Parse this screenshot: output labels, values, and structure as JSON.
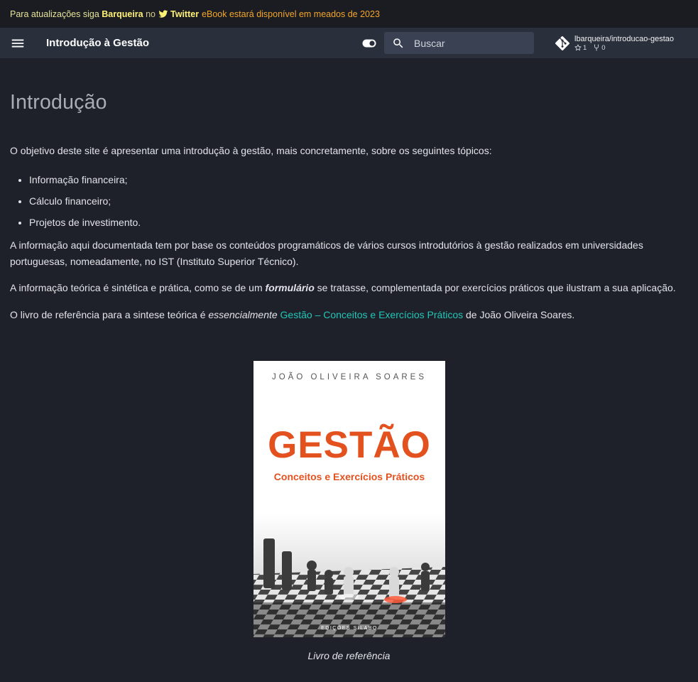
{
  "announcement": {
    "prefix": "Para atualizações siga",
    "name": "Barqueira",
    "connector": "no",
    "platform": "Twitter",
    "suffix": "eBook estará disponível em meados de 2023"
  },
  "header": {
    "title": "Introdução à Gestão",
    "search_placeholder": "Buscar",
    "repo": {
      "name": "lbarqueira/introducao-gestao",
      "stars": "1",
      "forks": "0"
    }
  },
  "main": {
    "heading": "Introdução",
    "intro": "O objetivo deste site é apresentar uma introdução à gestão, mais concretamente, sobre os seguintes tópicos:",
    "topics": [
      "Informação financeira;",
      "Cálculo financeiro;",
      "Projetos de investimento."
    ],
    "para_info": "A informação aqui documentada tem por base os conteúdos programáticos de vários cursos introdutórios à gestão realizados em universidades portuguesas, nomeadamente, no IST (Instituto Superior Técnico).",
    "para_theory_a": "A informação teórica é sintética e prática, como se de um ",
    "para_theory_em": "formulário",
    "para_theory_b": " se tratasse, complementada por exercícios práticos que ilustram a sua aplicação.",
    "para_ref_a": "O livro de referência para a sintese teórica é ",
    "para_ref_em": "essencialmente",
    "para_ref_link": "Gestão – Conceitos e Exercícios Práticos",
    "para_ref_b": " de João Oliveira Soares.",
    "book": {
      "author": "JOÃO OLIVEIRA SOARES",
      "title": "GESTÃO",
      "subtitle": "Conceitos e Exercícios Práticos",
      "publisher": "EDIÇÕES SÍLABO"
    },
    "caption": "Livro de referência"
  },
  "colors": {
    "background": "#1e2129",
    "header": "#2a2f3c",
    "link": "#22c7b8",
    "accent_orange": "#e3511f"
  }
}
